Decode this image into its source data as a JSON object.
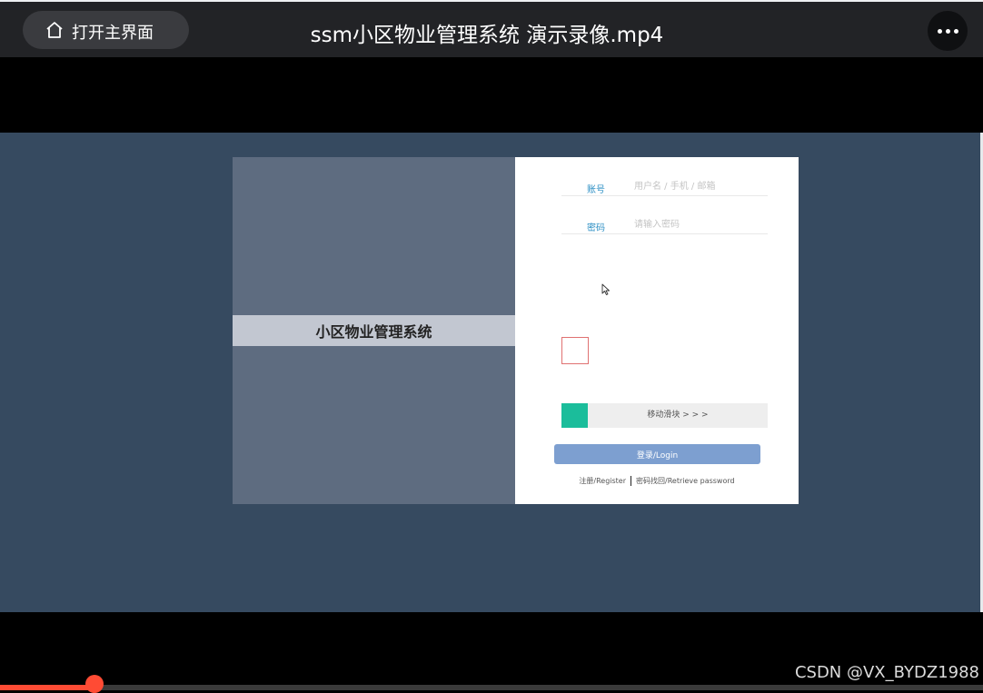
{
  "player": {
    "home_label": "打开主界面",
    "title": "ssm小区物业管理系统 演示录像.mp4",
    "progress": 0.096,
    "watermark": "CSDN @VX_BYDZ1988"
  },
  "login": {
    "system_title": "小区物业管理系统",
    "account_label": "账号",
    "account_placeholder": "用户名 / 手机 / 邮箱",
    "password_label": "密码",
    "password_placeholder": "请输入密码",
    "slider_text": "移动滑块 > > >",
    "login_button": "登录/Login",
    "register_link": "注册/Register",
    "retrieve_link": "密码找回/Retrieve password"
  },
  "colors": {
    "accent_teal": "#1bbd9b",
    "login_button": "#7d9fd0",
    "progress": "#ff4b34",
    "stage_bg": "#364a60"
  }
}
